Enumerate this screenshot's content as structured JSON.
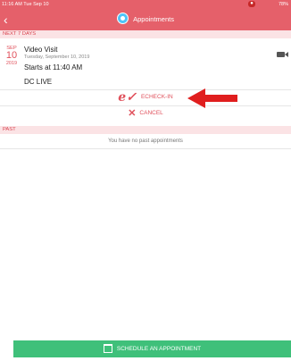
{
  "status": {
    "time": "11:16 AM",
    "date": "Tue Sep 10",
    "right": "78%"
  },
  "header": {
    "title": "Appointments"
  },
  "sections": {
    "upcoming_label": "NEXT 7 DAYS",
    "past_label": "PAST"
  },
  "appointment": {
    "month": "SEP",
    "day": "10",
    "year": "2019",
    "title": "Video Visit",
    "full_date": "Tuesday, September 10, 2019",
    "starts": "Starts at 11:40 AM",
    "location": "DC LIVE"
  },
  "actions": {
    "echeckin_label": "ECHECK-IN",
    "cancel_label": "CANCEL"
  },
  "past": {
    "empty_message": "You have no past appointments"
  },
  "footer": {
    "schedule_label": "SCHEDULE AN APPOINTMENT"
  },
  "colors": {
    "header": "#e5606a",
    "accent": "#e0515c",
    "section_bg": "#fbe3e5",
    "schedule_button": "#3fc07a",
    "arrow": "#e01e1e"
  },
  "icons": [
    "back-chevron-icon",
    "appointments-logo-icon",
    "video-camera-icon",
    "echeckin-icon",
    "cancel-x-icon",
    "calendar-icon",
    "red-arrow-icon"
  ]
}
